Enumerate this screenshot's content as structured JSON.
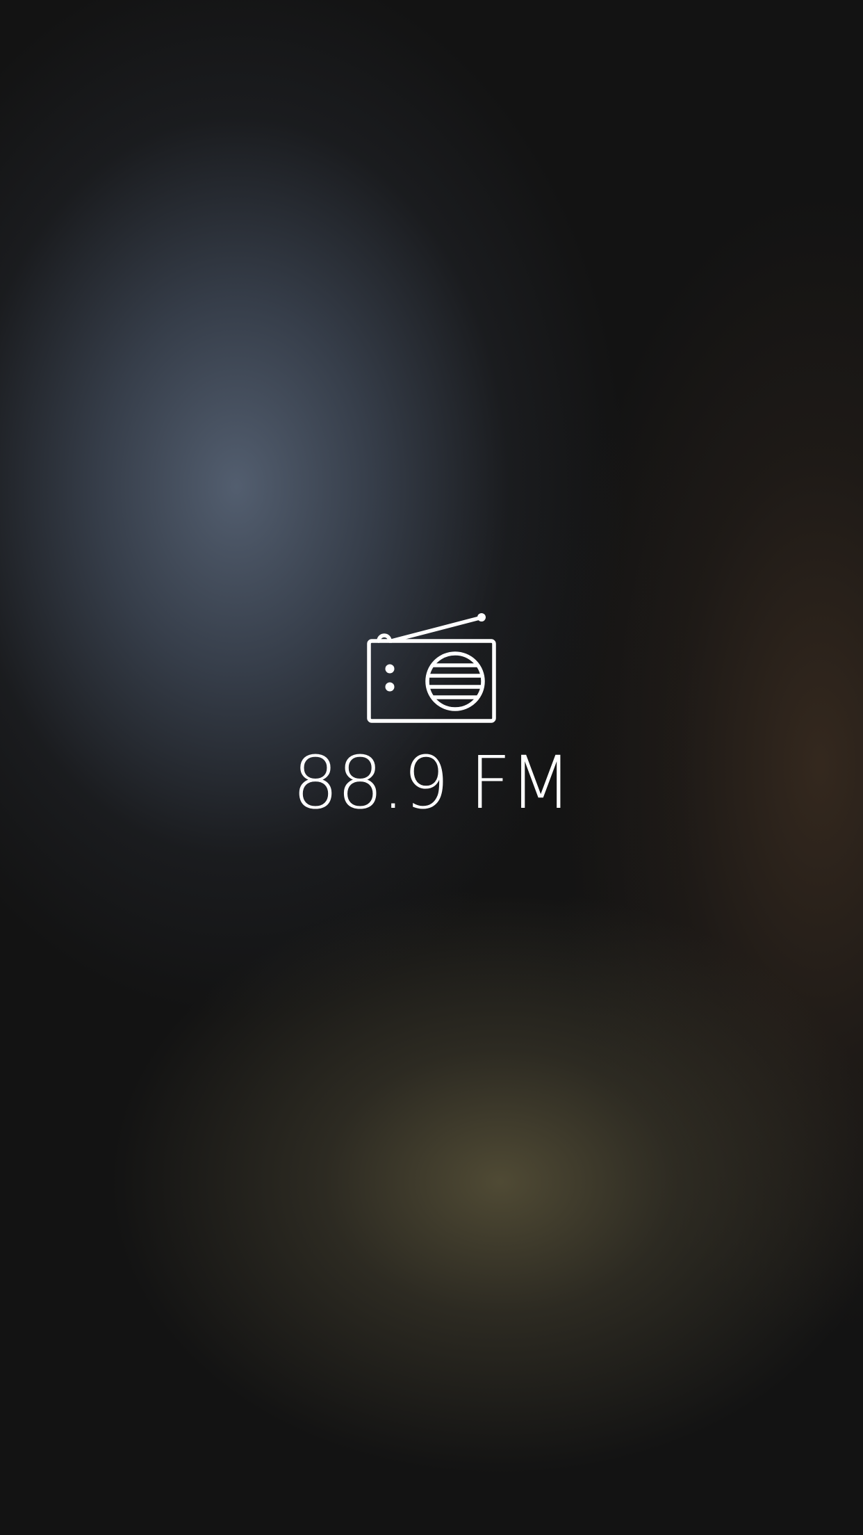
{
  "station": {
    "icon": "radio-icon",
    "frequency": "88.9 FM"
  },
  "colors": {
    "background": "#131313",
    "foreground": "#ffffff"
  }
}
